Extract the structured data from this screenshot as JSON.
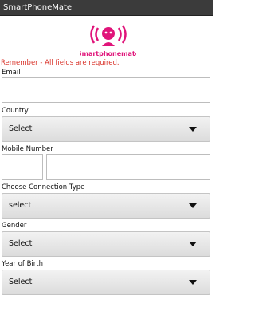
{
  "app": {
    "title": "SmartPhoneMate"
  },
  "logo": {
    "text": "[Smartphonemate]",
    "brand_color": "#e0147a"
  },
  "form": {
    "notice": "Remember - All fields are required.",
    "email": {
      "label": "Email",
      "value": ""
    },
    "country": {
      "label": "Country",
      "selected": "Select"
    },
    "mobile": {
      "label": "Mobile Number",
      "code_value": "",
      "number_value": ""
    },
    "connection_type": {
      "label": "Choose Connection Type",
      "selected": "select"
    },
    "gender": {
      "label": "Gender",
      "selected": "Select"
    },
    "year_of_birth": {
      "label": "Year of Birth",
      "selected": "Select"
    }
  },
  "colors": {
    "title_bar": "#3b3b3b",
    "notice_text": "#d9342b",
    "brand": "#e0147a"
  },
  "icons": {
    "dropdown": "triangle-down",
    "logo_symbol": "radio-signal-head"
  }
}
